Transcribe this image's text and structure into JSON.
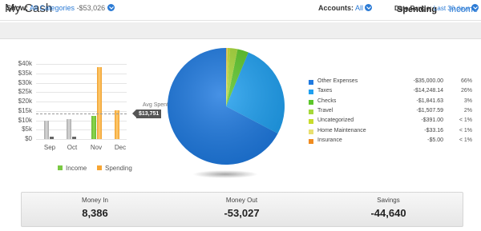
{
  "header": {
    "title": "My Cash",
    "tabs": [
      {
        "label": "Spending",
        "active": true
      },
      {
        "label": "Income",
        "active": false
      }
    ]
  },
  "filter": {
    "show_label": "Show:",
    "show_value": "All Categories",
    "show_amount": "-$53,026",
    "accounts_label": "Accounts:",
    "accounts_value": "All",
    "date_label": "Date Range:",
    "date_value": "Last 30 days"
  },
  "colors": {
    "accent": "#2a7ad5",
    "income": "#7ac943",
    "spending": "#f7a532",
    "history_bar": "#bcbcbc"
  },
  "chart_data": [
    {
      "type": "bar",
      "categories": [
        "Sep",
        "Oct",
        "Nov",
        "Dec"
      ],
      "ylim": [
        0,
        40000
      ],
      "yticks": [
        "$0",
        "$5k",
        "$10k",
        "$15k",
        "$20k",
        "$25k",
        "$30k",
        "$35k",
        "$40k"
      ],
      "series": [
        {
          "name": "Income",
          "values": [
            0,
            0,
            12500,
            0
          ]
        },
        {
          "name": "Spending",
          "values": [
            10000,
            10500,
            38500,
            15500
          ]
        }
      ],
      "avg_spent_label": "Avg Spent",
      "avg_spent_value": "$13,751",
      "avg_spent_number": 13751,
      "legend": [
        "Income",
        "Spending"
      ]
    },
    {
      "type": "pie",
      "slices": [
        {
          "name": "Other Expenses",
          "amount": "-$35,000.00",
          "pct": "66%",
          "value": 66,
          "color": "#1f7ae0"
        },
        {
          "name": "Taxes",
          "amount": "-$14,248.14",
          "pct": "26%",
          "value": 26,
          "color": "#20a0f0"
        },
        {
          "name": "Checks",
          "amount": "-$1,841.63",
          "pct": "3%",
          "value": 3,
          "color": "#5cc62a"
        },
        {
          "name": "Travel",
          "amount": "-$1,507.59",
          "pct": "2%",
          "value": 2,
          "color": "#a6d83a"
        },
        {
          "name": "Uncategorized",
          "amount": "-$391.00",
          "pct": "< 1%",
          "value": 0.7,
          "color": "#c8dc2c"
        },
        {
          "name": "Home Maintenance",
          "amount": "-$33.16",
          "pct": "< 1%",
          "value": 0.3,
          "color": "#e8e070"
        },
        {
          "name": "Insurance",
          "amount": "-$5.00",
          "pct": "< 1%",
          "value": 0.1,
          "color": "#f08c20"
        }
      ]
    }
  ],
  "summary": {
    "money_in_label": "Money In",
    "money_in_value": "8,386",
    "money_out_label": "Money Out",
    "money_out_value": "-53,027",
    "savings_label": "Savings",
    "savings_value": "-44,640"
  }
}
